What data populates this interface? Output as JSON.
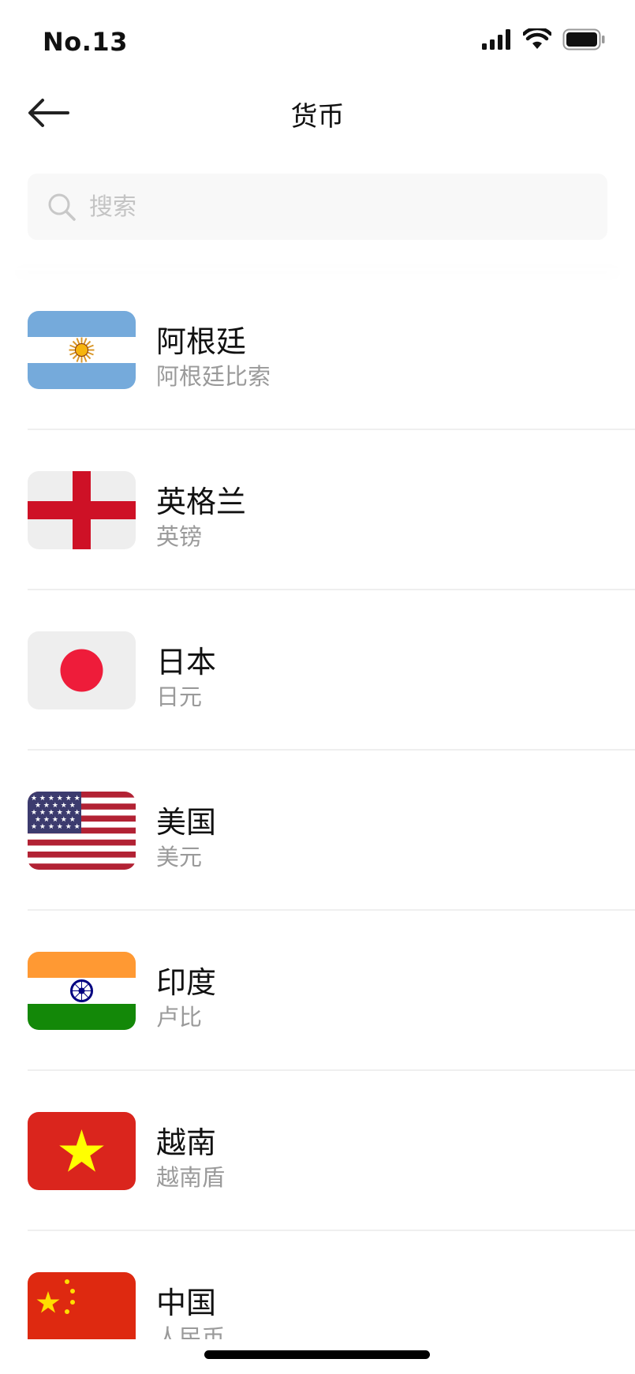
{
  "status_bar": {
    "time": "No.13",
    "icons": [
      "signal-icon",
      "wifi-icon",
      "battery-icon"
    ]
  },
  "nav": {
    "title": "货币",
    "back_icon": "arrow-left-icon"
  },
  "search": {
    "placeholder": "搜索",
    "value": "",
    "icon": "search-icon"
  },
  "currencies": [
    {
      "country": "阿根廷",
      "currency": "阿根廷比索",
      "flag": "argentina-flag-icon"
    },
    {
      "country": "英格兰",
      "currency": "英镑",
      "flag": "england-flag-icon"
    },
    {
      "country": "日本",
      "currency": "日元",
      "flag": "japan-flag-icon"
    },
    {
      "country": "美国",
      "currency": "美元",
      "flag": "usa-flag-icon"
    },
    {
      "country": "印度",
      "currency": "卢比",
      "flag": "india-flag-icon"
    },
    {
      "country": "越南",
      "currency": "越南盾",
      "flag": "vietnam-flag-icon"
    },
    {
      "country": "中国",
      "currency": "人民币",
      "flag": "china-flag-icon"
    }
  ],
  "colors": {
    "divider": "#efefef",
    "secondary_text": "#9a9a9a",
    "search_bg": "#f8f8f8"
  }
}
